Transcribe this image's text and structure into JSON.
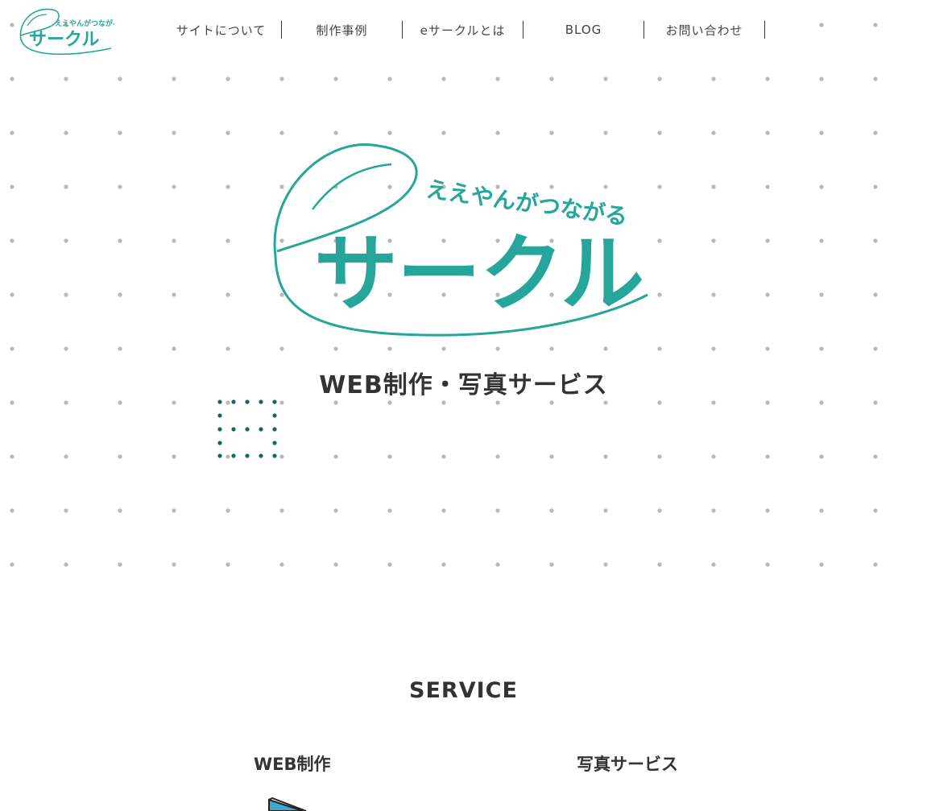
{
  "header": {
    "logo": {
      "tagline": "ええやんがつながる",
      "name": "サークル"
    },
    "nav": [
      {
        "label": "サイトについて"
      },
      {
        "label": "制作事例"
      },
      {
        "label": "eサークルとは"
      },
      {
        "label": "BLOG"
      },
      {
        "label": "お問い合わせ"
      }
    ]
  },
  "hero": {
    "logo": {
      "tagline": "ええやんがつながる",
      "name": "サークル"
    },
    "subtitle": "WEB制作・写真サービス"
  },
  "service": {
    "title": "SERVICE",
    "items": [
      {
        "label": "WEB制作",
        "icon": "monitor-icon"
      },
      {
        "label": "写真サービス"
      }
    ]
  },
  "colors": {
    "brand_teal": "#26a69a",
    "dot_gray": "#b8b8b8",
    "dot_dark_teal": "#0f6b5f",
    "text": "#333333"
  }
}
